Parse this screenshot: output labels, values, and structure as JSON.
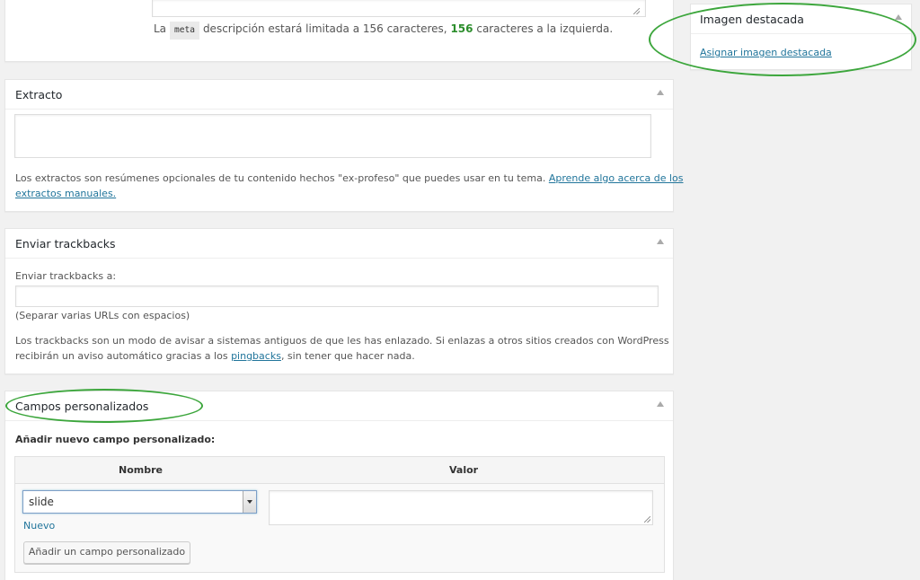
{
  "seo": {
    "desc_prefix": "La",
    "desc_code": "meta",
    "desc_middle": "descripción estará limitada a 156 caracteres,",
    "desc_count": "156",
    "desc_suffix": "caracteres a la izquierda."
  },
  "featured": {
    "title": "Imagen destacada",
    "link": "Asignar imagen destacada"
  },
  "excerpt": {
    "title": "Extracto",
    "help_line1": "Los extractos son resúmenes opcionales de tu contenido hechos \"ex-profeso\" que puedes usar en tu tema.",
    "help_link_line1": "Aprende algo acerca de los",
    "help_link_line2": "extractos manuales."
  },
  "trackbacks": {
    "title": "Enviar trackbacks",
    "label": "Enviar trackbacks a:",
    "hint": "(Separar varias URLs con espacios)",
    "info_line1": "Los trackbacks son un modo de avisar a sistemas antiguos de que les has enlazado. Si enlazas a otros sitios creados con WordPress",
    "info_line2_prefix": "recibirán un aviso automático gracias a los",
    "info_link": "pingbacks",
    "info_line2_suffix": ", sin tener que hacer nada."
  },
  "custom_fields": {
    "title": "Campos personalizados",
    "add_label": "Añadir nuevo campo personalizado:",
    "col_name": "Nombre",
    "col_value": "Valor",
    "selected_name": "slide",
    "new_link": "Nuevo",
    "add_button": "Añadir un campo personalizado"
  },
  "colors": {
    "annotation": "#3ca63c",
    "link": "#21759b"
  }
}
